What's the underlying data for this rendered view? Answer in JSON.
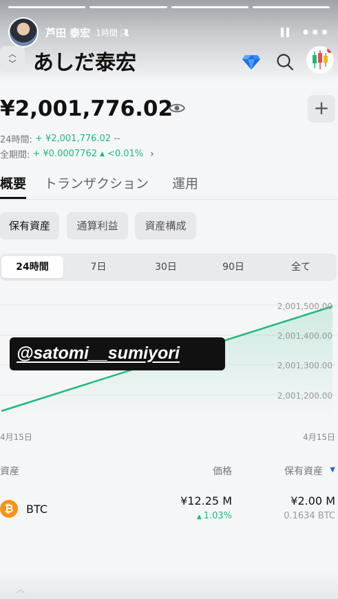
{
  "story": {
    "user_name": "芦田 泰宏",
    "posted_ago": "1時間",
    "progress_segments": 4
  },
  "app": {
    "account_name": "あしだ泰宏",
    "balance": "¥2,001,776.02",
    "pl_24h_label": "24時間:",
    "pl_24h_value": "+ ¥2,001,776.02",
    "pl_24h_pct": "--",
    "pl_all_label": "全期間:",
    "pl_all_value": "+ ¥0.0007762",
    "pl_all_pct": "<0.01%",
    "plus_label": "+"
  },
  "tabs": [
    {
      "label": "概要",
      "active": true
    },
    {
      "label": "トランザクション",
      "active": false
    },
    {
      "label": "運用",
      "active": false
    }
  ],
  "chips": [
    {
      "label": "保有資産",
      "active": true
    },
    {
      "label": "通算利益",
      "active": false
    },
    {
      "label": "資産構成",
      "active": false
    }
  ],
  "ranges": [
    {
      "label": "24時間",
      "active": true
    },
    {
      "label": "7日",
      "active": false
    },
    {
      "label": "30日",
      "active": false
    },
    {
      "label": "90日",
      "active": false
    },
    {
      "label": "全て",
      "active": false
    }
  ],
  "chart": {
    "y_ticks": [
      "2,001,500.00",
      "2,001,400.00",
      "2,001,300.00",
      "2,001,200.00"
    ],
    "x_start": "4月15日",
    "x_end": "4月15日",
    "line_color": "#1db97d"
  },
  "watermark": "@satomi__sumiyori",
  "list": {
    "col_asset": "資産",
    "col_price": "価格",
    "col_holding": "保有資産",
    "rows": [
      {
        "symbol": "BTC",
        "icon_glyph": "₿",
        "price": "¥12.25 M",
        "change": "1.03%",
        "holding_value": "¥2.00 M",
        "holding_qty": "0.1634 BTC"
      }
    ]
  },
  "colors": {
    "positive": "#1db97d",
    "btc": "#f7931a",
    "accent": "#2b63d9"
  }
}
